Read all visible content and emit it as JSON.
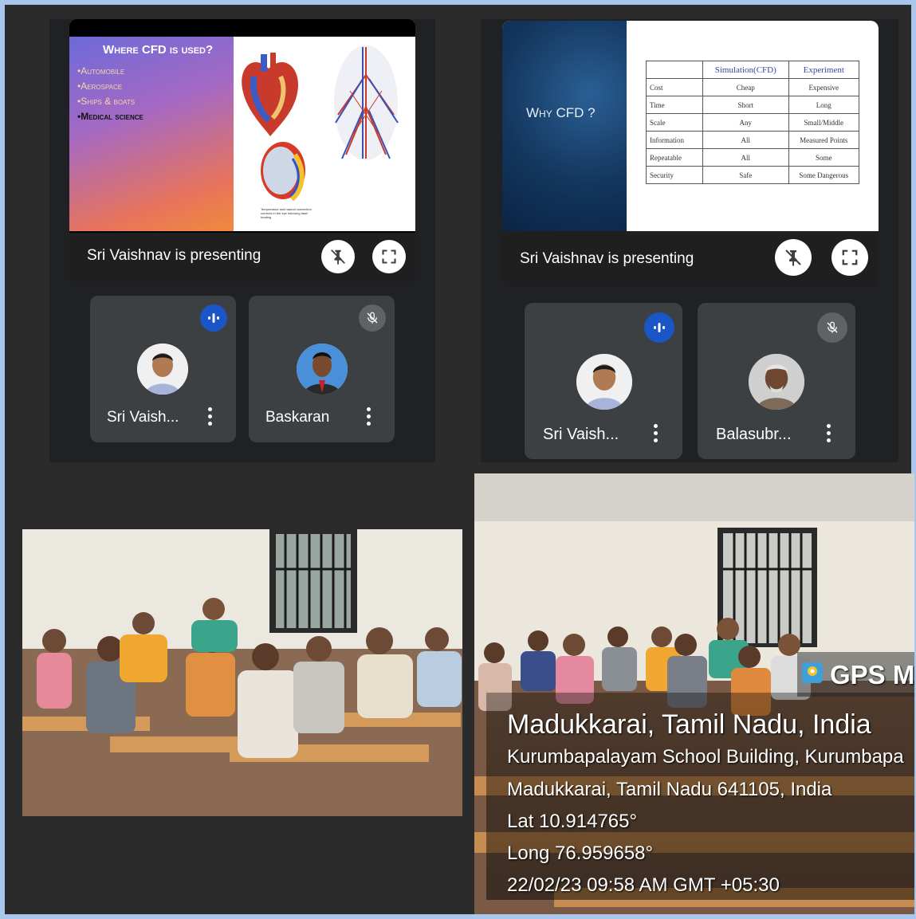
{
  "left_meet": {
    "slide": {
      "title": "Where CFD is used?",
      "bullets": [
        "Automobile",
        "Aerospace",
        "Ships & boats",
        "Medical science"
      ],
      "caption": "Temperature and natural convection currents in the eye following laser heating"
    },
    "presenting_text": "Sri Vaishnav is presenting",
    "participants": [
      {
        "name": "Sri Vaish...",
        "status": "speaking"
      },
      {
        "name": "Baskaran",
        "status": "muted"
      }
    ]
  },
  "right_meet": {
    "slide": {
      "title": "Why CFD ?",
      "table": {
        "headers": [
          "",
          "Simulation(CFD)",
          "Experiment"
        ],
        "rows": [
          [
            "Cost",
            "Cheap",
            "Expensive"
          ],
          [
            "Time",
            "Short",
            "Long"
          ],
          [
            "Scale",
            "Any",
            "Small/Middle"
          ],
          [
            "Information",
            "All",
            "Measured Points"
          ],
          [
            "Repeatable",
            "All",
            "Some"
          ],
          [
            "Security",
            "Safe",
            "Some Dangerous"
          ]
        ]
      }
    },
    "presenting_text": "Sri Vaishnav is presenting",
    "participants": [
      {
        "name": "Sri Vaish...",
        "status": "speaking"
      },
      {
        "name": "Balasubr...",
        "status": "muted"
      }
    ]
  },
  "gps_overlay": {
    "badge": "GPS M",
    "place": "Madukkarai, Tamil Nadu, India",
    "address1": "Kurumbapalayam School Building, Kurumbapa",
    "address2": "Madukkarai, Tamil Nadu 641105, India",
    "lat": "Lat 10.914765°",
    "long": "Long 76.959658°",
    "datetime": "22/02/23 09:58 AM GMT +05:30"
  },
  "colors": {
    "meet_bg": "#202124",
    "tile_bg": "#3c4043",
    "speaking_blue": "#1a56c8"
  }
}
